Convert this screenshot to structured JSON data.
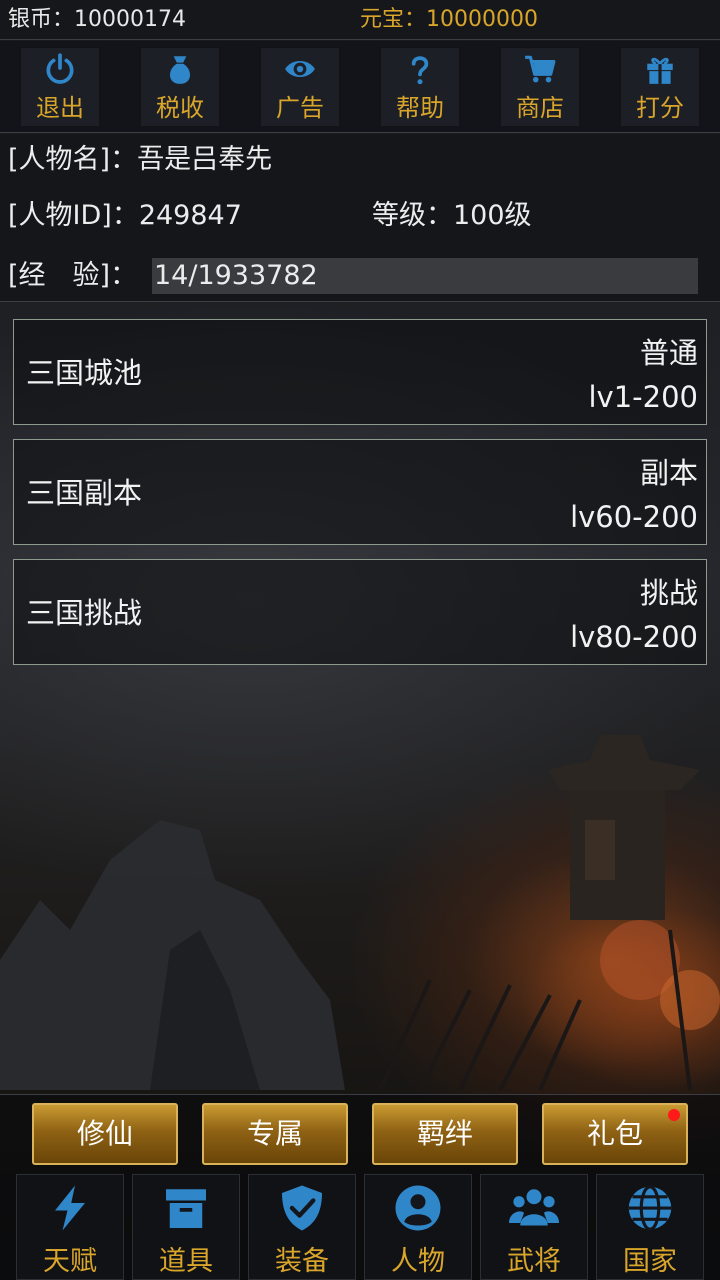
{
  "currency": {
    "silver_label": "银币：",
    "silver_value": "10000174",
    "gold_label": "元宝：",
    "gold_value": "10000000"
  },
  "actions": [
    {
      "label": "退出",
      "icon": "power-icon"
    },
    {
      "label": "税收",
      "icon": "money-bag-icon"
    },
    {
      "label": "广告",
      "icon": "eye-icon"
    },
    {
      "label": "帮助",
      "icon": "question-icon"
    },
    {
      "label": "商店",
      "icon": "cart-icon"
    },
    {
      "label": "打分",
      "icon": "gift-icon"
    }
  ],
  "character": {
    "name_label": "[人物名]：",
    "name": "吾是吕奉先",
    "id_label": "[人物ID]：",
    "id": "249847",
    "level_label": "等级：",
    "level": "100级",
    "exp_label": "[经　验]：",
    "exp": "14/1933782"
  },
  "modes": [
    {
      "name": "三国城池",
      "type": "普通",
      "range": "lv1-200"
    },
    {
      "name": "三国副本",
      "type": "副本",
      "range": "lv60-200"
    },
    {
      "name": "三国挑战",
      "type": "挑战",
      "range": "lv80-200"
    }
  ],
  "gold_buttons": [
    {
      "label": "修仙"
    },
    {
      "label": "专属"
    },
    {
      "label": "羁绊"
    },
    {
      "label": "礼包",
      "badge": true
    }
  ],
  "bottom_nav": [
    {
      "label": "天赋",
      "icon": "lightning-icon"
    },
    {
      "label": "道具",
      "icon": "box-icon"
    },
    {
      "label": "装备",
      "icon": "shield-check-icon"
    },
    {
      "label": "人物",
      "icon": "person-icon"
    },
    {
      "label": "武将",
      "icon": "group-icon"
    },
    {
      "label": "国家",
      "icon": "globe-icon"
    }
  ],
  "colors": {
    "accent_gold": "#d9a52a",
    "icon_blue": "#2f86c9",
    "badge_red": "#ff1a1a"
  }
}
